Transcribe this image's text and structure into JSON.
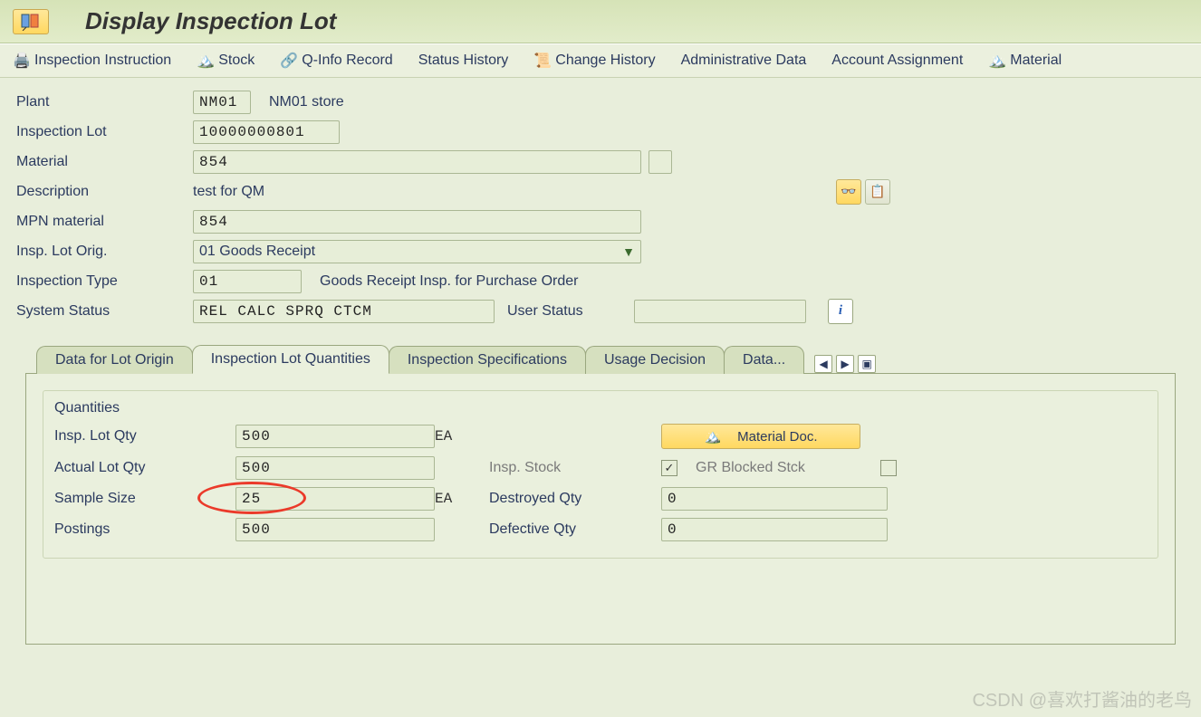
{
  "title": "Display Inspection Lot",
  "toolbar": {
    "inspection_instruction": "Inspection Instruction",
    "stock": "Stock",
    "qinfo": "Q-Info Record",
    "status_history": "Status History",
    "change_history": "Change History",
    "admin_data": "Administrative Data",
    "account_assignment": "Account Assignment",
    "material": "Material"
  },
  "header": {
    "plant_label": "Plant",
    "plant_code": "NM01",
    "plant_name": "NM01 store",
    "insp_lot_label": "Inspection Lot",
    "insp_lot_value": "10000000801",
    "material_label": "Material",
    "material_value": "854",
    "description_label": "Description",
    "description_value": "test for QM",
    "mpn_label": "MPN material",
    "mpn_value": "854",
    "orig_label": "Insp. Lot Orig.",
    "orig_value": "01 Goods Receipt",
    "insp_type_label": "Inspection Type",
    "insp_type_value": "01",
    "insp_type_text": "Goods Receipt Insp. for Purchase Order",
    "sys_status_label": "System Status",
    "sys_status_value": "REL  CALC SPRQ CTCM",
    "user_status_label": "User Status",
    "user_status_value": ""
  },
  "tabs": {
    "t1": "Data for Lot Origin",
    "t2": "Inspection Lot Quantities",
    "t3": "Inspection Specifications",
    "t4": "Usage Decision",
    "t5": "Data..."
  },
  "quantities": {
    "group_title": "Quantities",
    "insp_lot_qty_label": "Insp. Lot Qty",
    "insp_lot_qty": "500",
    "actual_lot_qty_label": "Actual Lot Qty",
    "actual_lot_qty": "500",
    "sample_size_label": "Sample Size",
    "sample_size": "25",
    "postings_label": "Postings",
    "postings": "500",
    "unit1": "EA",
    "unit2": "EA",
    "material_doc_btn": "Material Doc.",
    "insp_stock_label": "Insp. Stock",
    "insp_stock_checked": true,
    "gr_blocked_label": "GR Blocked Stck",
    "gr_blocked_checked": false,
    "destroyed_qty_label": "Destroyed Qty",
    "destroyed_qty": "0",
    "defective_qty_label": "Defective Qty",
    "defective_qty": "0"
  },
  "watermark": "CSDN @喜欢打酱油的老鸟"
}
